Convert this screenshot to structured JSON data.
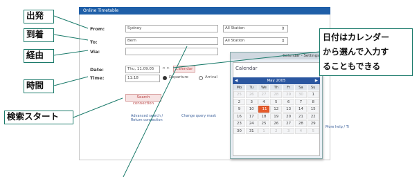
{
  "window": {
    "title": "Online Timetable"
  },
  "form": {
    "from_label": "From:",
    "from_value": "Sydney",
    "to_label": "To:",
    "to_value": "Bern",
    "via_label": "Via:",
    "via_value": "",
    "date_label": "Date:",
    "date_value": "Thu, 11.09.05",
    "date_prev": "< >",
    "calendar_link": "Calendar",
    "time_label": "Time:",
    "time_value": "11:18",
    "departure_label": "Departure",
    "arrival_label": "Arrival",
    "station_select_1": "All Station",
    "station_select_2": "All Station",
    "search_button": "Search connection",
    "advanced_link": "Advanced search / Return connection",
    "change_link": "Change query mask",
    "side_text": "More help / Ti"
  },
  "calendar": {
    "window_label": "Calendar - Settings",
    "header": "Calendar",
    "month": "May 2005",
    "dow": [
      "Mo",
      "Tu",
      "We",
      "Th",
      "Fr",
      "Sa",
      "Su"
    ],
    "weeks": [
      [
        "25",
        "26",
        "27",
        "28",
        "29",
        "30",
        "1"
      ],
      [
        "2",
        "3",
        "4",
        "5",
        "6",
        "7",
        "8"
      ],
      [
        "9",
        "10",
        "11",
        "12",
        "13",
        "14",
        "15"
      ],
      [
        "16",
        "17",
        "18",
        "19",
        "20",
        "21",
        "22"
      ],
      [
        "23",
        "24",
        "25",
        "26",
        "27",
        "28",
        "29"
      ],
      [
        "30",
        "31",
        "1",
        "2",
        "3",
        "4",
        "5"
      ]
    ],
    "selected_day": "11"
  },
  "callouts": {
    "depart": "出発",
    "arrive": "到着",
    "via": "経由",
    "time": "時間",
    "search_start": "検索スタート",
    "calendar_note_1": "日付はカレンダー",
    "calendar_note_2": "から選んで入力す",
    "calendar_note_3": "ることもできる"
  },
  "colors": {
    "titlebar": "#1f5fa8",
    "callout_border": "#1a7a6a",
    "selected_day": "#e55a2b"
  }
}
